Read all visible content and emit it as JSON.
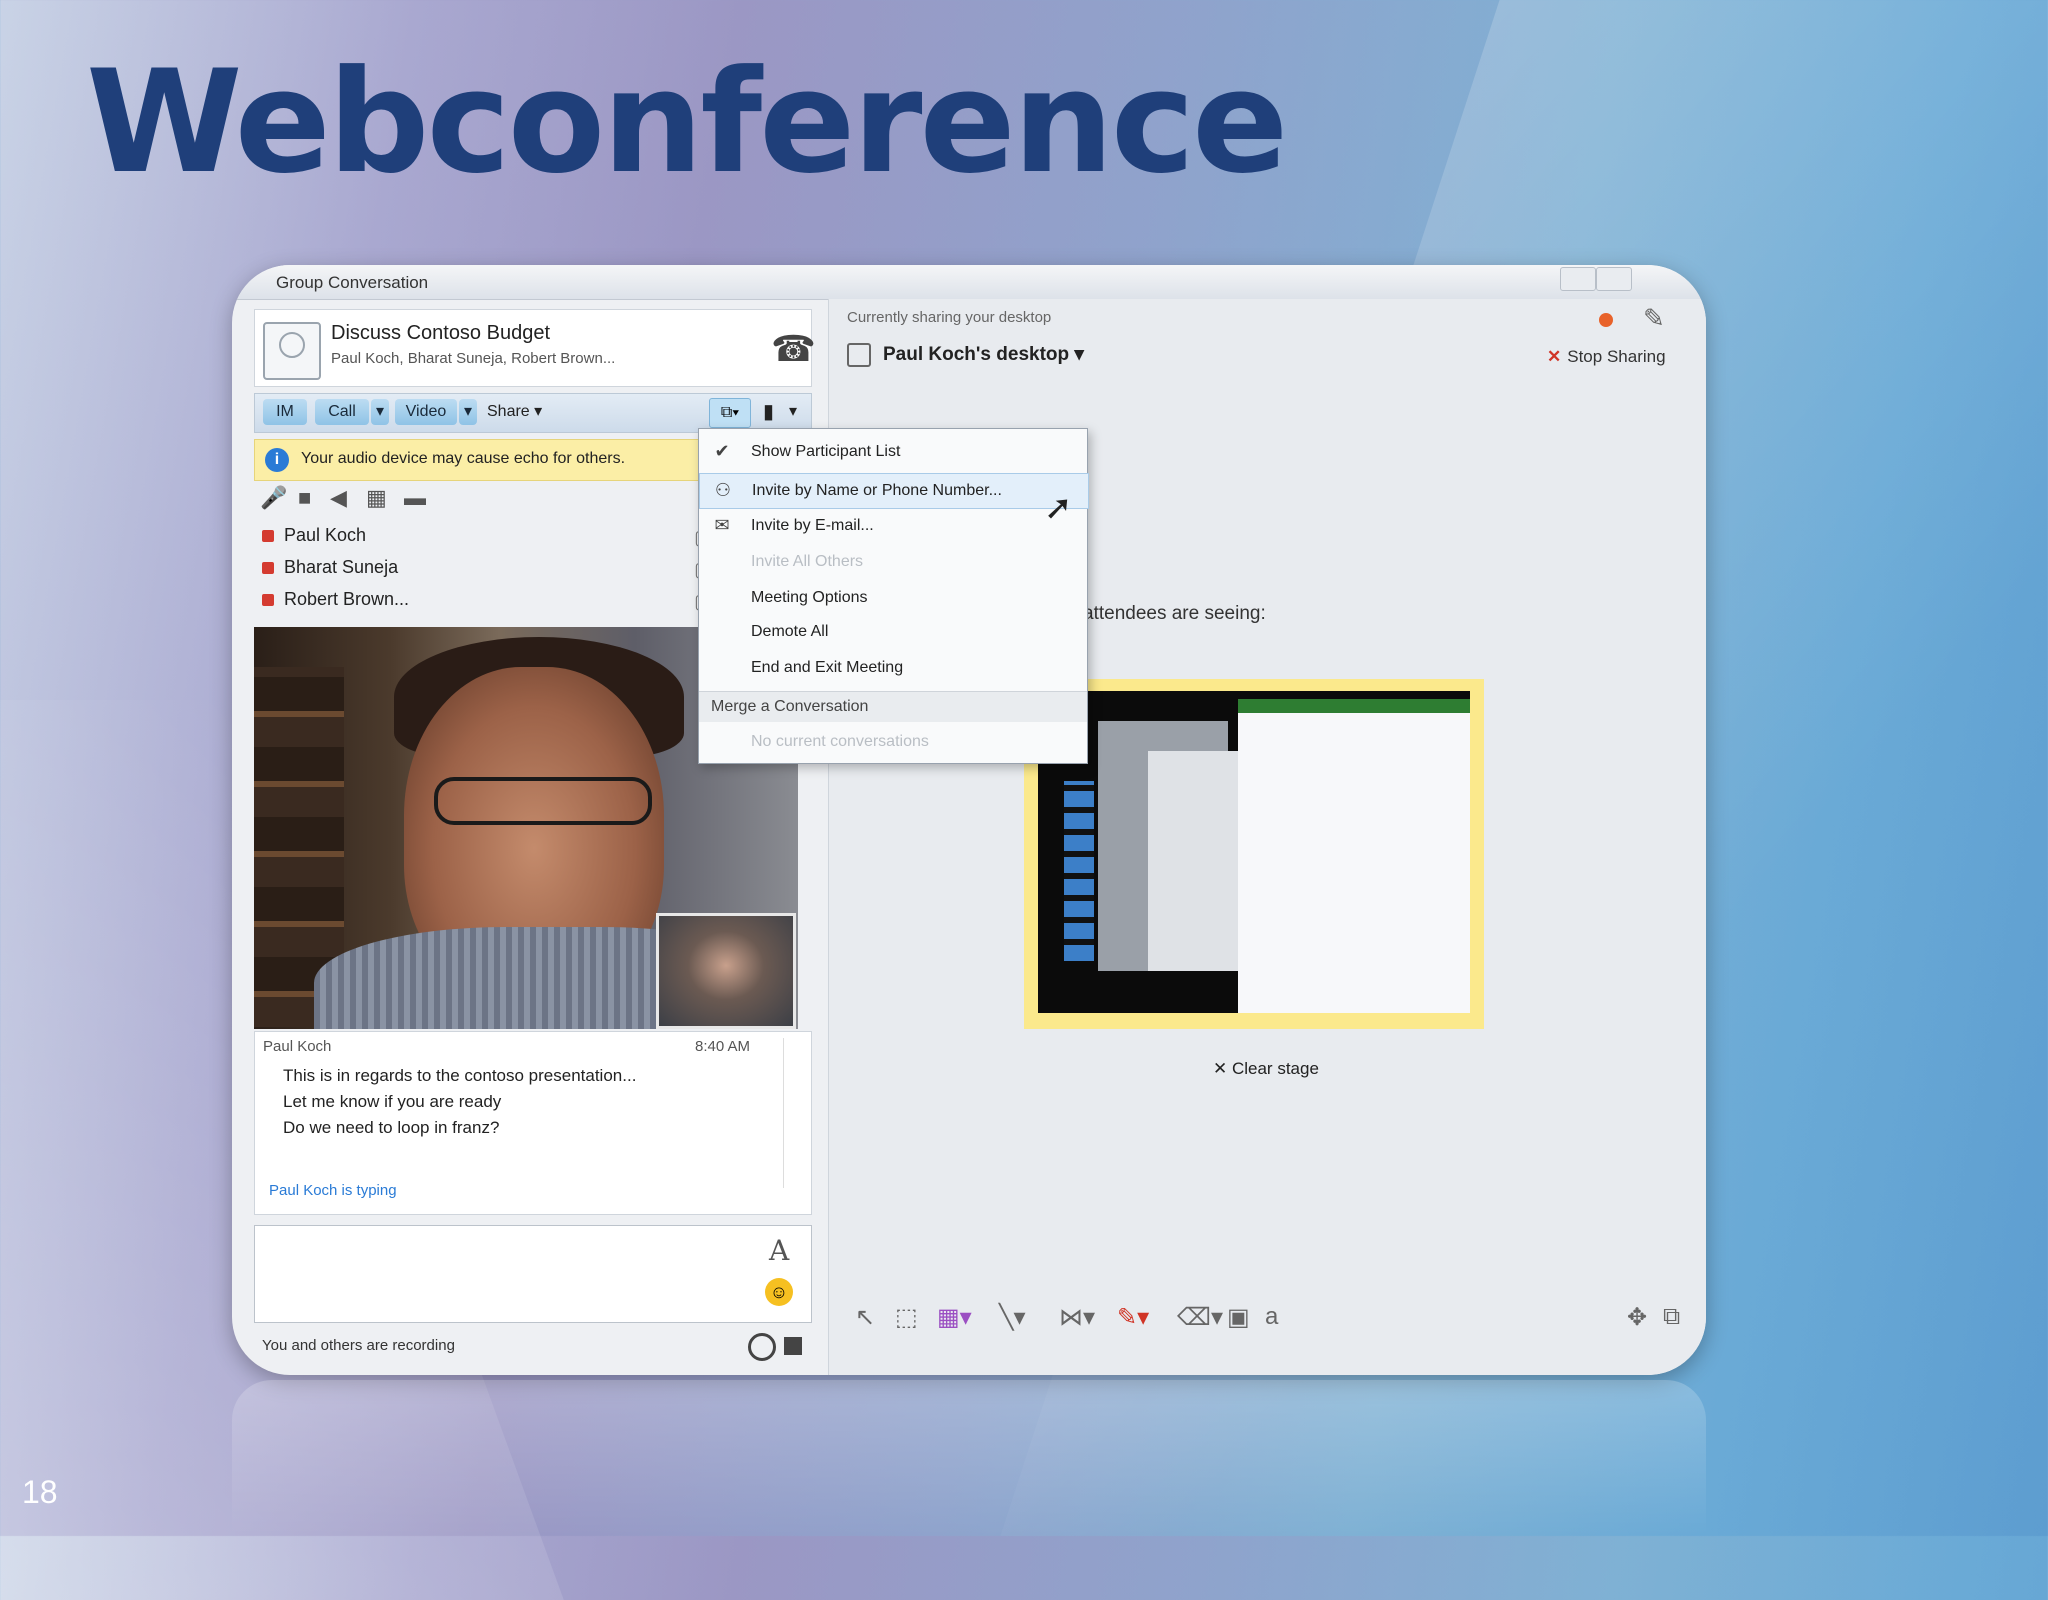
{
  "slide": {
    "title": "Webconference",
    "page_number": "18"
  },
  "window": {
    "title": "Group Conversation"
  },
  "conversation": {
    "title": "Discuss Contoso Budget",
    "participants_line": "Paul Koch, Bharat Suneja, Robert Brown..."
  },
  "toolbar": {
    "im": "IM",
    "call": "Call",
    "video": "Video",
    "share": "Share ▾",
    "arrow": "▾"
  },
  "warning": {
    "text": "Your audio device may cause echo for others."
  },
  "participants": [
    "Paul Koch",
    "Bharat Suneja",
    "Robert Brown..."
  ],
  "chat": {
    "sender": "Paul Koch",
    "time": "8:40 AM",
    "messages": [
      "This is in regards to the contoso presentation...",
      "Let me know if you are ready",
      "Do we need to loop in franz?"
    ],
    "typing": "Paul Koch is typing"
  },
  "status": {
    "text": "You and others are recording"
  },
  "sharing": {
    "status": "Currently sharing your desktop",
    "desktop": "Paul Koch's desktop ▾",
    "stop_label": "Stop Sharing",
    "attendees_label": "attendees are seeing:",
    "clear_stage": "✕ Clear stage"
  },
  "menu": {
    "items": [
      {
        "label": "Show Participant List",
        "state": "checked"
      },
      {
        "label": "Invite by Name or Phone Number...",
        "state": "highlighted"
      },
      {
        "label": "Invite by E-mail...",
        "state": "normal"
      },
      {
        "label": "Invite All Others",
        "state": "disabled"
      },
      {
        "label": "Meeting Options",
        "state": "normal"
      },
      {
        "label": "Demote All",
        "state": "normal"
      },
      {
        "label": "End and Exit Meeting",
        "state": "normal"
      }
    ],
    "section": "Merge a Conversation",
    "empty": "No current conversations"
  }
}
